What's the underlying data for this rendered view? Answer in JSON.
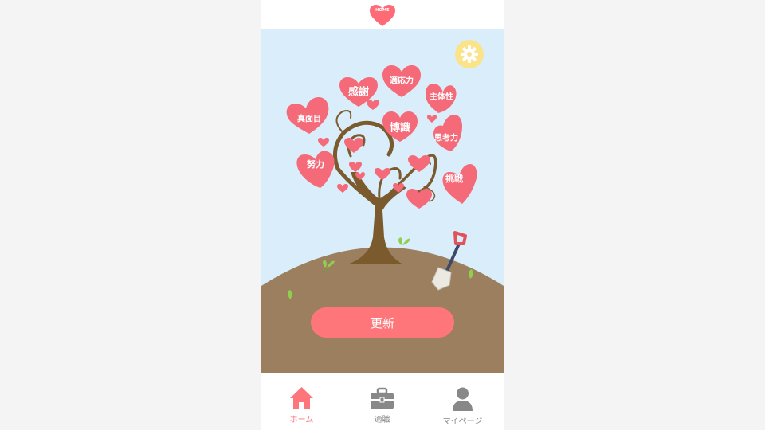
{
  "header": {
    "logo_text": "HOME"
  },
  "tree": {
    "hearts": [
      {
        "id": "kansha",
        "label": "感謝"
      },
      {
        "id": "tekiouryoku",
        "label": "適応力"
      },
      {
        "id": "shutaisei",
        "label": "主体性"
      },
      {
        "id": "majime",
        "label": "真面目"
      },
      {
        "id": "hakushiki",
        "label": "博識"
      },
      {
        "id": "shikouryoku",
        "label": "思考力"
      },
      {
        "id": "doryoku",
        "label": "努力"
      },
      {
        "id": "chousen",
        "label": "挑戦"
      }
    ]
  },
  "main": {
    "update_label": "更新"
  },
  "tabbar": {
    "tabs": [
      {
        "label": "ホーム",
        "icon": "home-icon",
        "active": true
      },
      {
        "label": "適職",
        "icon": "briefcase-icon",
        "active": false
      },
      {
        "label": "マイページ",
        "icon": "user-icon",
        "active": false
      }
    ]
  },
  "colors": {
    "accent": "#fe7679",
    "sky": "#d9eefa",
    "ground": "#9b7f5e",
    "trunk": "#7b5a2d",
    "gear_bg": "#fbe389",
    "inactive": "#888888"
  }
}
